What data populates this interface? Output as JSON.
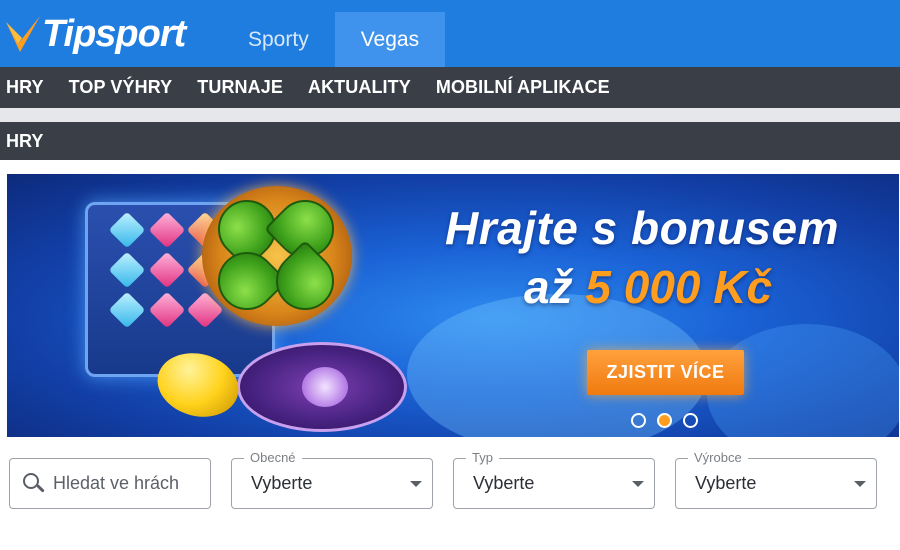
{
  "header": {
    "logo_text": "Tipsport",
    "nav": [
      {
        "label": "Sporty",
        "active": false
      },
      {
        "label": "Vegas",
        "active": true
      }
    ],
    "brand_color": "#1f7de0",
    "accent_color": "#ff9d1e"
  },
  "subnav": {
    "items": [
      "HRY",
      "TOP VÝHRY",
      "TURNAJE",
      "AKTUALITY",
      "MOBILNÍ APLIKACE"
    ]
  },
  "breadcrumb": {
    "current": "HRY"
  },
  "banner": {
    "line1": "Hrajte s bonusem",
    "line2_prefix": "až ",
    "line2_amount": "5 000 Kč",
    "cta_label": "ZJISTIT VÍCE",
    "slides_total": 3,
    "active_slide": 2
  },
  "filters": {
    "search_placeholder": "Hledat ve hrách",
    "selects": [
      {
        "legend": "Obecné",
        "value": "Vyberte"
      },
      {
        "legend": "Typ",
        "value": "Vyberte"
      },
      {
        "legend": "Výrobce",
        "value": "Vyberte"
      }
    ]
  }
}
